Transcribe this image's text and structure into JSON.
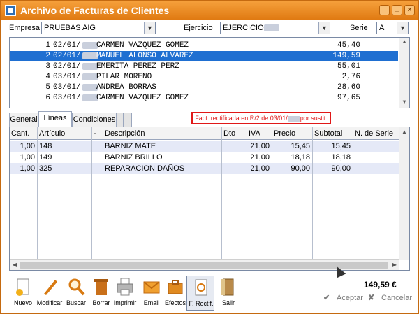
{
  "window": {
    "title": "Archivo de Facturas de Clientes",
    "accent": "#e98a1c",
    "selection_color": "#1f6fd1",
    "alert_color": "#e01818"
  },
  "filters": {
    "empresa_label": "Empresa",
    "empresa_value": "PRUEBAS AIG",
    "ejercicio_label": "Ejercicio",
    "ejercicio_value": "EJERCICIO",
    "serie_label": "Serie",
    "serie_value": "A"
  },
  "invoices": [
    {
      "num": "1",
      "date": "02/01/",
      "name": "CARMEN VAZQUEZ GOMEZ",
      "amount": "45,40"
    },
    {
      "num": "2",
      "date": "02/01/",
      "name": "MANUEL ALONSO ALVAREZ",
      "amount": "149,59"
    },
    {
      "num": "3",
      "date": "02/01/",
      "name": "EMERITA PEREZ PERZ",
      "amount": "55,01"
    },
    {
      "num": "4",
      "date": "03/01/",
      "name": "PILAR MORENO",
      "amount": "2,76"
    },
    {
      "num": "5",
      "date": "03/01/",
      "name": "ANDREA BORRAS",
      "amount": "28,60"
    },
    {
      "num": "6",
      "date": "03/01/",
      "name": "CARMEN VAZQUEZ GOMEZ",
      "amount": "97,65"
    }
  ],
  "selected_invoice_index": 1,
  "tabs": [
    "General",
    "Líneas",
    "Condiciones"
  ],
  "active_tab": "Líneas",
  "rectification_note": {
    "prefix": "Fact. rectificada en R/2 de 03/01/",
    "suffix": "por sustit."
  },
  "lines_table": {
    "headers": [
      "Cant.",
      "Artículo",
      "-",
      "Descripción",
      "Dto",
      "IVA",
      "Precio",
      "Subtotal",
      "N. de Serie"
    ],
    "rows": [
      {
        "cant": "1,00",
        "articulo": "148",
        "descripcion": "BARNIZ MATE",
        "dto": "",
        "iva": "21,00",
        "precio": "15,45",
        "subtotal": "15,45"
      },
      {
        "cant": "1,00",
        "articulo": "149",
        "descripcion": "BARNIZ BRILLO",
        "dto": "",
        "iva": "21,00",
        "precio": "18,18",
        "subtotal": "18,18"
      },
      {
        "cant": "1,00",
        "articulo": "325",
        "descripcion": "REPARACION DAÑOS",
        "dto": "",
        "iva": "21,00",
        "precio": "90,00",
        "subtotal": "90,00"
      }
    ]
  },
  "toolbar": [
    {
      "label": "Nuevo",
      "icon": "new-document-icon"
    },
    {
      "label": "Modificar",
      "icon": "pen-icon"
    },
    {
      "label": "Buscar",
      "icon": "magnifier-icon"
    },
    {
      "label": "Borrar",
      "icon": "trash-icon"
    },
    {
      "label": "Imprimir",
      "icon": "printer-icon"
    },
    {
      "label": "Email",
      "icon": "envelope-icon"
    },
    {
      "label": "Efectos",
      "icon": "briefcase-icon"
    },
    {
      "label": "F. Rectif.",
      "icon": "rectify-document-icon"
    },
    {
      "label": "Salir",
      "icon": "door-exit-icon"
    }
  ],
  "total": "149,59 €",
  "actions": {
    "accept_label": "Aceptar",
    "cancel_label": "Cancelar"
  }
}
